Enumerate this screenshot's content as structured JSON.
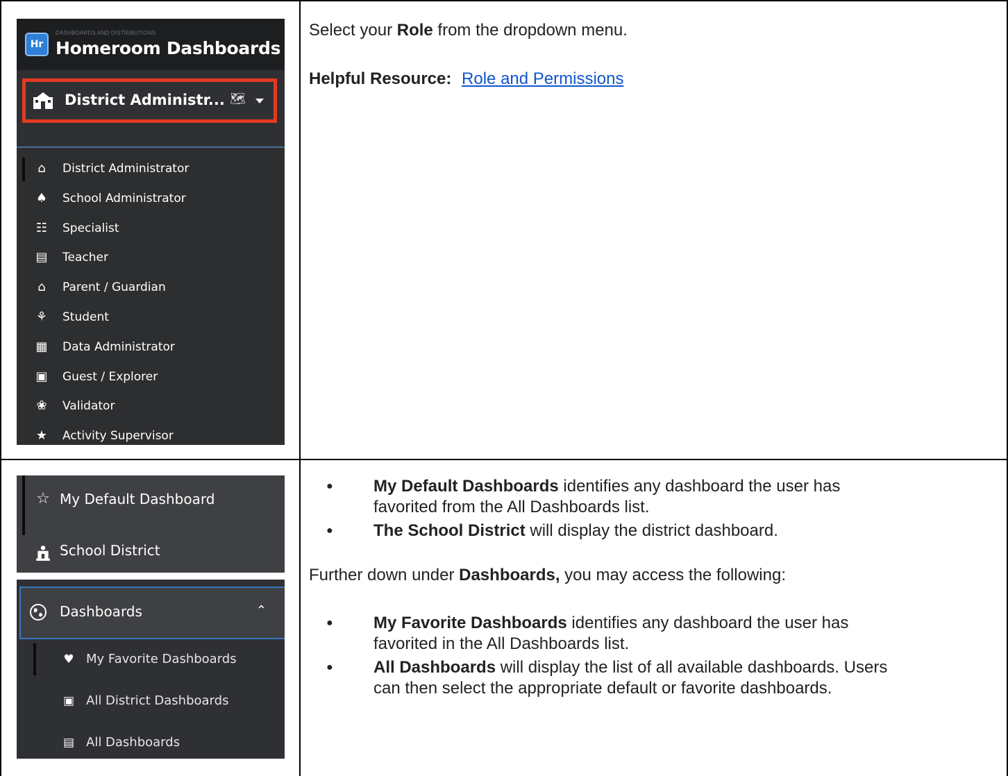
{
  "sidebar_top": {
    "logo": "Hr",
    "app_subtitle": "DASHBOARDS AND DISTRIBUTIONS",
    "app_title": "Homeroom Dashboards",
    "selected_role": "District Administr...",
    "roles": [
      {
        "label": "District Administrator",
        "icon": "school-building-icon"
      },
      {
        "label": "School Administrator",
        "icon": "desk-apple-icon"
      },
      {
        "label": "Specialist",
        "icon": "document-search-icon"
      },
      {
        "label": "Teacher",
        "icon": "chalkboard-icon"
      },
      {
        "label": "Parent / Guardian",
        "icon": "home-heart-icon"
      },
      {
        "label": "Student",
        "icon": "graduation-cap-icon"
      },
      {
        "label": "Data Administrator",
        "icon": "data-admin-icon"
      },
      {
        "label": "Guest / Explorer",
        "icon": "backpack-icon"
      },
      {
        "label": "Validator",
        "icon": "award-ribbon-icon"
      },
      {
        "label": "Activity Supervisor",
        "icon": "stars-icon"
      }
    ]
  },
  "instructions_top": {
    "line1_pre": "Select your ",
    "line1_bold": "Role",
    "line1_post": " from the dropdown menu.",
    "resource_label": "Helpful Resource:",
    "resource_link": "Role and Permissions"
  },
  "sidebar_bottom": {
    "items": [
      {
        "label": "My Default Dashboard",
        "icon": "star-outline-icon"
      },
      {
        "label": "School District",
        "icon": "school-district-icon"
      }
    ],
    "section_label": "Dashboards",
    "sub_items": [
      {
        "label": "My Favorite Dashboards",
        "icon": "favorite-dashboard-icon"
      },
      {
        "label": "All District Dashboards",
        "icon": "district-dashboard-icon"
      },
      {
        "label": "All Dashboards",
        "icon": "all-dashboards-icon"
      }
    ]
  },
  "instructions_bottom": {
    "bullets1": [
      {
        "bold": "My Default Dashboards",
        "line1": " identifies any dashboard the user has",
        "line2": "favorited from the All Dashboards list."
      },
      {
        "bold": "The School District",
        "line1": " will display the district dashboard.",
        "line2": ""
      }
    ],
    "para_pre": "Further down under ",
    "para_bold": "Dashboards,",
    "para_post": " you may access the following:",
    "bullets2": [
      {
        "bold": "My Favorite Dashboards",
        "line1": " identifies any dashboard the user has",
        "line2": "favorited in the All Dashboards list."
      },
      {
        "bold": "All Dashboards",
        "line1": " will display the list of all available dashboards. Users",
        "line2": "can then select the appropriate default or favorite dashboards."
      }
    ]
  }
}
